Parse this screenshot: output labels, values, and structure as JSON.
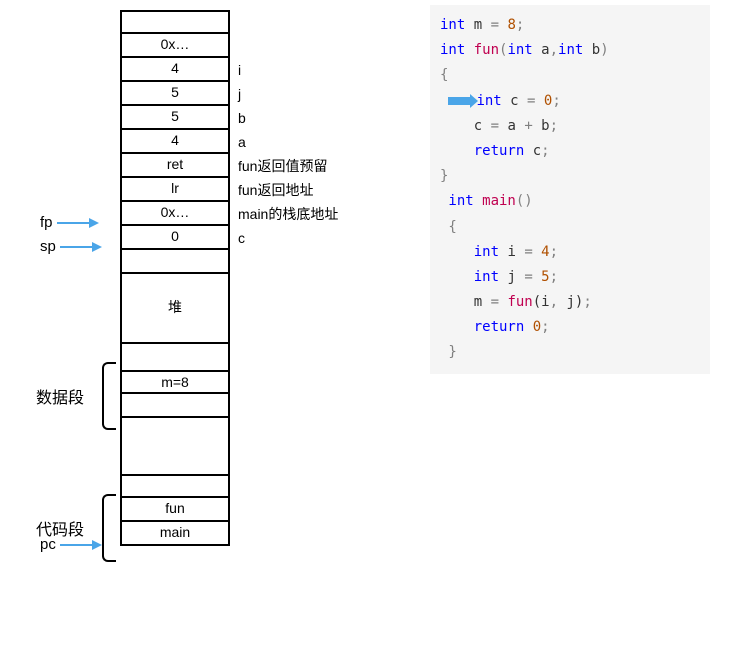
{
  "pointers": {
    "fp": "fp",
    "sp": "sp",
    "pc": "pc"
  },
  "sections": {
    "data": "数据段",
    "code": "代码段"
  },
  "stack": {
    "r0": "",
    "r1": "0x…",
    "r2": "4",
    "r3": "5",
    "r4": "5",
    "r5": "4",
    "r6": "ret",
    "r7": "lr",
    "r8": "0x…",
    "r9": "0",
    "r10": "",
    "heap": "堆",
    "m": "m=8",
    "blank1": "",
    "blank2": "",
    "fun": "fun",
    "main": "main"
  },
  "labels": {
    "l0": "",
    "l1": "",
    "l2": "i",
    "l3": "j",
    "l4": "b",
    "l5": "a",
    "l6": "fun返回值预留",
    "l7": "fun返回地址",
    "l8": "main的栈底地址",
    "l9": "c"
  },
  "code": {
    "l1a": "int",
    "l1b": " m ",
    "l1c": "=",
    "l1d": " 8",
    "l1e": ";",
    "l2a": "int",
    "l2b": " fun",
    "l2c": "(",
    "l2d": "int",
    "l2e": " a",
    "l2f": ",",
    "l2g": "int",
    "l2h": " b",
    "l2i": ")",
    "l3": "{",
    "l4a": "int",
    "l4b": " c ",
    "l4c": "=",
    "l4d": " 0",
    "l4e": ";",
    "l5a": "    c ",
    "l5b": "=",
    "l5c": " a ",
    "l5d": "+",
    "l5e": " b",
    "l5f": ";",
    "l6a": "    return",
    "l6b": " c",
    "l6c": ";",
    "l7": "}",
    "l8a": " int",
    "l8b": " main",
    "l8c": "()",
    "l9": " {",
    "l10a": "    int",
    "l10b": " i ",
    "l10c": "=",
    "l10d": " 4",
    "l10e": ";",
    "l11a": "    int",
    "l11b": " j ",
    "l11c": "=",
    "l11d": " 5",
    "l11e": ";",
    "l12a": "    m ",
    "l12b": "=",
    "l12c": " fun",
    "l12d": "(i",
    "l12e": ",",
    "l12f": " j)",
    "l12g": ";",
    "l13a": "    return",
    "l13b": " 0",
    "l13c": ";",
    "l14": " }"
  }
}
